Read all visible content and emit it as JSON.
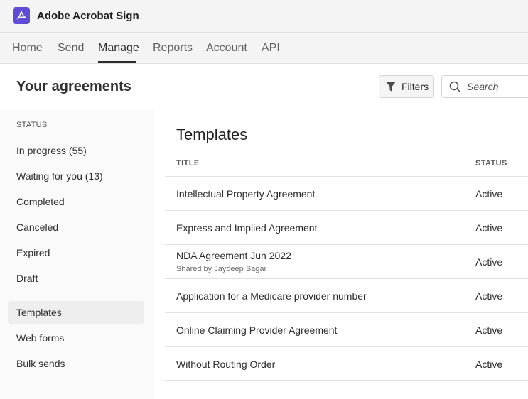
{
  "app": {
    "name": "Adobe Acrobat Sign",
    "logo_color": "#5c4cd6"
  },
  "nav": {
    "items": [
      {
        "label": "Home",
        "active": false
      },
      {
        "label": "Send",
        "active": false
      },
      {
        "label": "Manage",
        "active": true
      },
      {
        "label": "Reports",
        "active": false
      },
      {
        "label": "Account",
        "active": false
      },
      {
        "label": "API",
        "active": false
      }
    ]
  },
  "header": {
    "title": "Your agreements",
    "filters_label": "Filters",
    "search_placeholder": "Search"
  },
  "sidebar": {
    "heading": "STATUS",
    "items": [
      {
        "label": "In progress (55)"
      },
      {
        "label": "Waiting for you (13)"
      },
      {
        "label": "Completed"
      },
      {
        "label": "Canceled"
      },
      {
        "label": "Expired"
      },
      {
        "label": "Draft"
      },
      {
        "label": "Templates",
        "selected": true
      },
      {
        "label": "Web forms"
      },
      {
        "label": "Bulk sends"
      }
    ]
  },
  "main": {
    "title": "Templates",
    "columns": {
      "title": "TITLE",
      "status": "STATUS"
    },
    "rows": [
      {
        "title": "Intellectual Property Agreement",
        "subtitle": "",
        "status": "Active"
      },
      {
        "title": "Express and Implied Agreement",
        "subtitle": "",
        "status": "Active"
      },
      {
        "title": "NDA Agreement Jun 2022",
        "subtitle": "Shared by Jaydeep Sagar",
        "status": "Active"
      },
      {
        "title": "Application for a Medicare provider number",
        "subtitle": "",
        "status": "Active"
      },
      {
        "title": "Online Claiming Provider Agreement",
        "subtitle": "",
        "status": "Active"
      },
      {
        "title": "Without Routing Order",
        "subtitle": "",
        "status": "Active"
      }
    ]
  }
}
